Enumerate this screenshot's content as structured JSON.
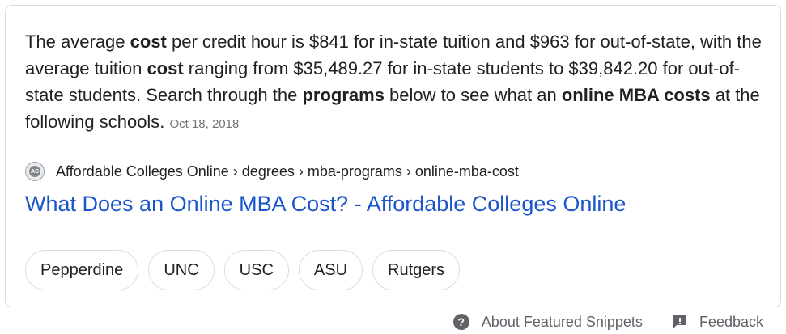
{
  "snippet": {
    "t1": "The average ",
    "b1": "cost",
    "t2": " per credit hour is $841 for in-state tuition and $963 for out-of-state, with the average tuition ",
    "b2": "cost",
    "t3": " ranging from $35,489.27 for in-state students to $39,842.20 for out-of-state students. Search through the ",
    "b3": "programs",
    "t4": " below to see what an ",
    "b4": "online MBA costs",
    "t5": " at the following schools.",
    "date": "Oct 18, 2018"
  },
  "source": {
    "favicon_icon": "affordable-colleges-favicon",
    "favicon_text": "AC",
    "breadcrumb": "Affordable Colleges Online › degrees › mba-programs › online-mba-cost"
  },
  "result": {
    "title": "What Does an Online MBA Cost? - Affordable Colleges Online"
  },
  "chips": [
    "Pepperdine",
    "UNC",
    "USC",
    "ASU",
    "Rutgers"
  ],
  "footer": {
    "about_label": "About Featured Snippets",
    "about_icon": "help-circle-icon",
    "help_glyph": "?",
    "feedback_label": "Feedback",
    "feedback_icon": "feedback-icon"
  },
  "colors": {
    "link": "#1a56c9",
    "text": "#202124",
    "muted": "#70757a",
    "border": "#dadce0"
  }
}
